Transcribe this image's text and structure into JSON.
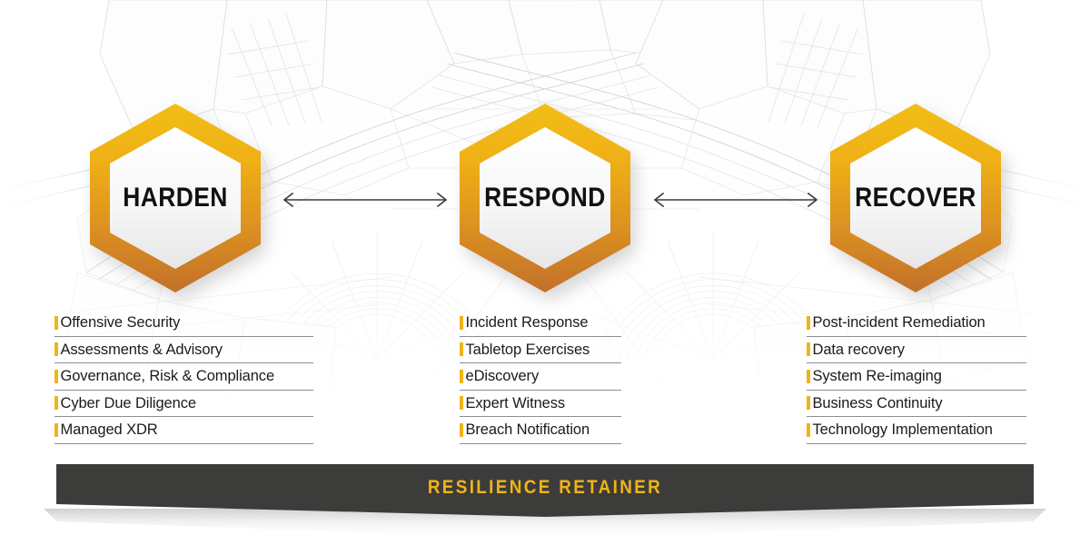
{
  "theme": {
    "gold": "#F0B417",
    "gold_dark": "#C8752A",
    "banner_bg": "#3C3C3B",
    "text_dark": "#1B1B1B",
    "rule": "#8D8E90",
    "page_bg": "#FFFFFF"
  },
  "background": {
    "name": "low-poly wireframe mesh",
    "line_color": "#D2D3D5"
  },
  "phases": [
    {
      "key": "harden",
      "label": "HARDEN",
      "services": [
        "Offensive Security",
        "Assessments & Advisory",
        "Governance, Risk & Compliance",
        "Cyber Due Diligence",
        "Managed XDR"
      ]
    },
    {
      "key": "respond",
      "label": "RESPOND",
      "services": [
        "Incident Response",
        "Tabletop Exercises",
        "eDiscovery",
        "Expert Witness",
        "Breach Notification"
      ]
    },
    {
      "key": "recover",
      "label": "RECOVER",
      "services": [
        "Post-incident Remediation",
        "Data recovery",
        "System Re-imaging",
        "Business Continuity",
        "Technology Implementation"
      ]
    }
  ],
  "connectors": [
    {
      "from": "harden",
      "to": "respond",
      "style": "double-arrow"
    },
    {
      "from": "respond",
      "to": "recover",
      "style": "double-arrow"
    }
  ],
  "banner": {
    "label": "RESILIENCE RETAINER"
  }
}
